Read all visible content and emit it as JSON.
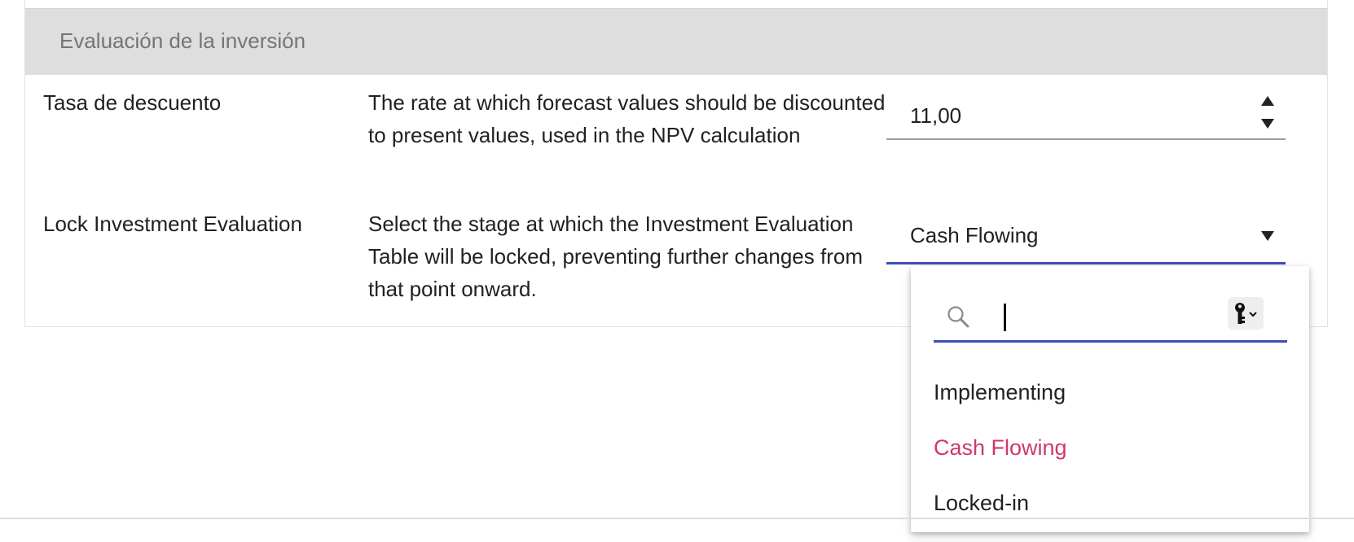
{
  "section": {
    "title": "Evaluación de la inversión"
  },
  "rows": [
    {
      "label": "Tasa de descuento",
      "description": "The rate at which forecast values should be discounted to present values, used in the NPV calculation",
      "value": "11,00"
    },
    {
      "label": "Lock Investment Evaluation",
      "description": "Select the stage at which the Investment Evaluation Table will be locked, preventing further changes from that point onward.",
      "value": "Cash Flowing"
    }
  ],
  "dropdown": {
    "search": {
      "value": "",
      "icon": "search-icon",
      "key_icon": "key-dropdown-icon"
    },
    "options": [
      "Implementing",
      "Cash Flowing",
      "Locked-in"
    ],
    "selected": "Cash Flowing"
  },
  "colors": {
    "accent": "#3f4db8",
    "selected_option": "#d0376c",
    "header_bg": "#dedede"
  }
}
